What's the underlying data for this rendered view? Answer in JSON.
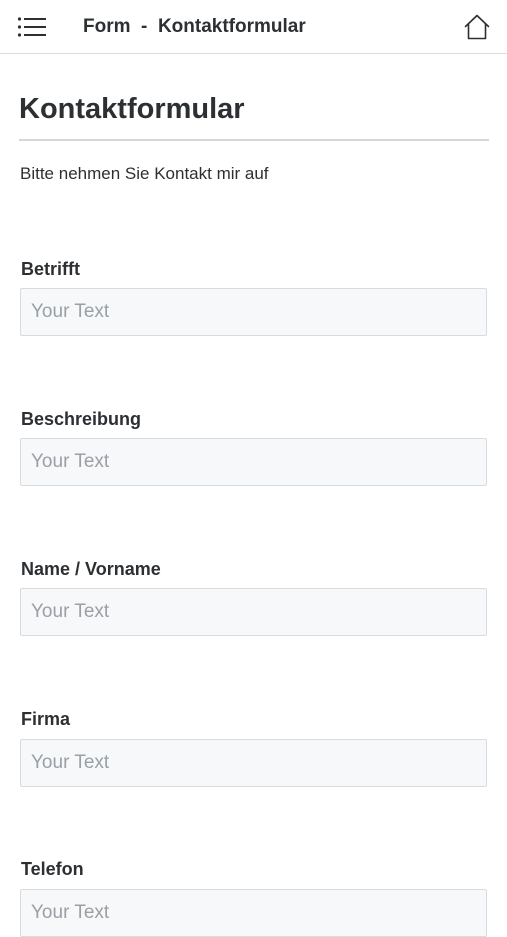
{
  "header": {
    "title": "Form  -  Kontaktformular",
    "menu_icon": "hamburger-list-icon",
    "home_icon": "home-icon"
  },
  "page": {
    "title": "Kontaktformular",
    "intro": "Bitte nehmen Sie Kontakt mir auf"
  },
  "form": {
    "fields": [
      {
        "label": "Betrifft",
        "placeholder": "Your Text",
        "value": ""
      },
      {
        "label": "Beschreibung",
        "placeholder": "Your Text",
        "value": ""
      },
      {
        "label": "Name / Vorname",
        "placeholder": "Your Text",
        "value": ""
      },
      {
        "label": "Firma",
        "placeholder": "Your Text",
        "value": ""
      },
      {
        "label": "Telefon",
        "placeholder": "Your Text",
        "value": ""
      }
    ]
  },
  "colors": {
    "text": "#2d3033",
    "input_background": "#f6f8fa",
    "input_border": "#d7dce1",
    "placeholder": "#9aa0a6"
  }
}
